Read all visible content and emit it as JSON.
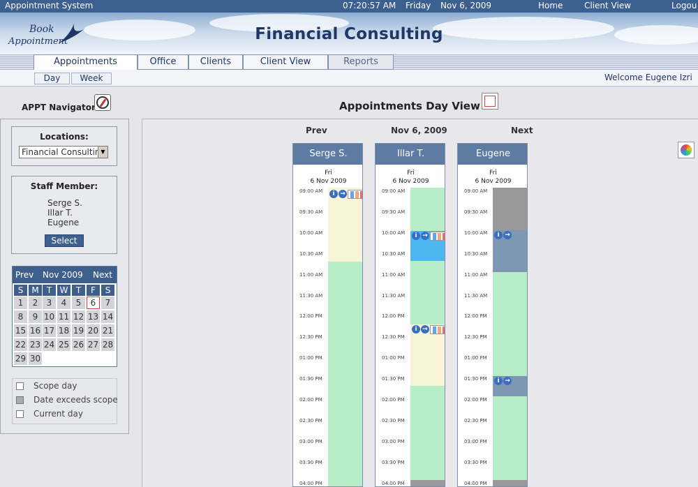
{
  "topbar": {
    "app_name": "Appointment System",
    "time": "07:20:57 AM",
    "weekday": "Friday",
    "date": "Nov 6, 2009",
    "home": "Home",
    "client_view": "Client View",
    "logout": "Logou"
  },
  "banner": {
    "logo_line1": "Book",
    "logo_line2": "Appointment",
    "title": "Financial Consulting"
  },
  "tabs": {
    "appointments": "Appointments",
    "office": "Office",
    "clients": "Clients",
    "client_view": "Client View",
    "reports": "Reports"
  },
  "subnav": {
    "day": "Day",
    "week": "Week",
    "welcome": "Welcome Eugene Izri"
  },
  "navigator": {
    "title": "APPT Navigator",
    "locations_label": "Locations:",
    "location_value": "Financial Consulting",
    "staff_label": "Staff Member:",
    "staff": [
      "Serge S.",
      "Illar T.",
      "Eugene"
    ],
    "select_button": "Select"
  },
  "mini_calendar": {
    "prev": "Prev",
    "month": "Nov 2009",
    "next": "Next",
    "dow": [
      "S",
      "M",
      "T",
      "W",
      "T",
      "F",
      "S"
    ],
    "days": [
      "1",
      "2",
      "3",
      "4",
      "5",
      "6",
      "7",
      "8",
      "9",
      "10",
      "11",
      "12",
      "13",
      "14",
      "15",
      "16",
      "17",
      "18",
      "19",
      "20",
      "21",
      "22",
      "23",
      "24",
      "25",
      "26",
      "27",
      "28",
      "29",
      "30"
    ],
    "current_day": "6"
  },
  "legend": {
    "scope_day": "Scope day",
    "exceeds_scope": "Date exceeds scope",
    "current_day": "Current day"
  },
  "day_view": {
    "title": "Appointments Day View",
    "prev": "Prev",
    "date": "Nov 6, 2009",
    "next": "Next",
    "columns": [
      {
        "name": "Serge S.",
        "weekday": "Fri",
        "date": "6 Nov 2009"
      },
      {
        "name": "Illar T.",
        "weekday": "Fri",
        "date": "6 Nov 2009"
      },
      {
        "name": "Eugene",
        "weekday": "Fri",
        "date": "6 Nov 2009"
      }
    ],
    "time_slots": [
      "09:00 AM",
      "09:30 AM",
      "10:00 AM",
      "10:30 AM",
      "11:00 AM",
      "11:30 AM",
      "12:00 PM",
      "12:30 PM",
      "01:00 PM",
      "01:30 PM",
      "02:00 PM",
      "02:30 PM",
      "03:00 PM",
      "03:30 PM",
      "04:00 PM"
    ]
  },
  "colors": {
    "header_blue": "#3b5f8f",
    "column_head": "#5d7ba3",
    "available_green": "#b7edc7",
    "booked_yellow": "#f8f5d7",
    "selected_blue": "#4db7f0",
    "busy_slate": "#7f97b2",
    "blocked_gray": "#999999"
  }
}
